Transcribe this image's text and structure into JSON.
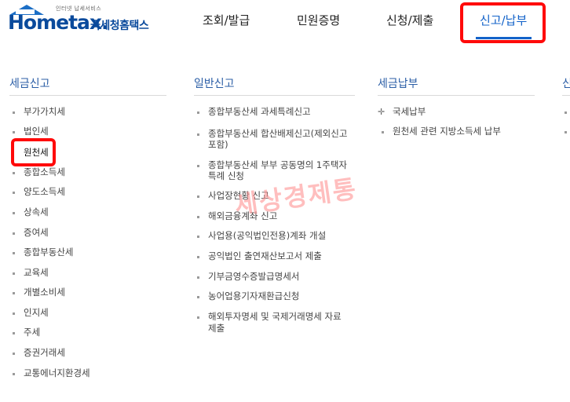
{
  "brand": {
    "tagline": "인터넷 납세서비스",
    "logo_text": "Hometax.",
    "name": "국세청홈택스"
  },
  "nav": {
    "items": [
      "조회/발급",
      "민원증명",
      "신청/제출"
    ],
    "active": "신고/납부"
  },
  "menu": {
    "col1": {
      "title": "세금신고",
      "items": [
        "부가가치세",
        "법인세",
        "원천세",
        "종합소득세",
        "양도소득세",
        "상속세",
        "증여세",
        "종합부동산세",
        "교육세",
        "개별소비세",
        "인지세",
        "주세",
        "증권거래세",
        "교통에너지환경세"
      ]
    },
    "col2": {
      "title": "일반신고",
      "items": [
        "종합부동산세 과세특례신고",
        "종합부동산세 합산배제신고(제외신고",
        "포함)",
        "종합부동산세 부부 공동명의 1주택자",
        "특례 신청",
        "사업장현황 신고",
        "해외금융계좌 신고",
        "사업용(공익법인전용)계좌 개설",
        "공익법인 출연재산보고서 제출",
        "기부금영수증발급명세서",
        "농어업용기자재환급신청",
        "해외투자명세 및 국제거래명세 자료",
        "제출"
      ]
    },
    "col3": {
      "title": "세금납부",
      "items": [
        "국세납부",
        "원천세 관련 지방소득세 납부"
      ]
    },
    "col4": {
      "title": "신"
    }
  },
  "watermark": "세상경제통",
  "colors": {
    "brand_blue": "#0a4a9c",
    "active_blue": "#1262c9",
    "highlight_red": "#ff0a0a",
    "section_title": "#2b5ea6"
  },
  "icons": {
    "nav_bullet": "square-bullet",
    "tax_payment": "plus-cross-icon"
  }
}
